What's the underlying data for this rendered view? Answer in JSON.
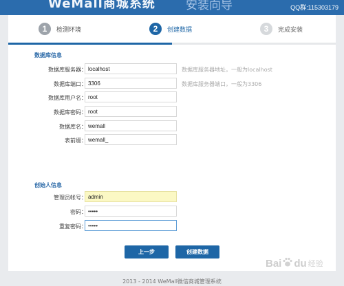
{
  "header": {
    "logo": "WeMall商城系统",
    "title": "安装向导",
    "qq": "QQ群:115303179"
  },
  "steps": [
    {
      "number": "1",
      "label": "检测环境",
      "state": "done"
    },
    {
      "number": "2",
      "label": "创建数据",
      "state": "active"
    },
    {
      "number": "3",
      "label": "完成安装",
      "state": "todo"
    }
  ],
  "progress": {
    "current_step": 2,
    "total_steps": 3,
    "fraction": 0.5
  },
  "database": {
    "section_title": "数据库信息",
    "server": {
      "label": "数据库服务器：",
      "value": "localhost",
      "hint": "数据库服务器地址，一般为localhost"
    },
    "port": {
      "label": "数据库端口：",
      "value": "3306",
      "hint": "数据库服务器端口，一般为3306"
    },
    "user": {
      "label": "数据库用户名：",
      "value": "root"
    },
    "password": {
      "label": "数据库密码：",
      "value": "root"
    },
    "name": {
      "label": "数据库名：",
      "value": "wemall"
    },
    "prefix": {
      "label": "表前缀：",
      "value": "wemall_"
    }
  },
  "founder": {
    "section_title": "创始人信息",
    "account": {
      "label": "管理员帐号：",
      "value": "admin"
    },
    "password": {
      "label": "密码：",
      "value": "admin"
    },
    "confirm": {
      "label": "重复密码：",
      "value": "admin"
    }
  },
  "buttons": {
    "prev": "上一步",
    "create": "创建数据"
  },
  "footer": "2013 - 2014 WeMall微信商城管理系统",
  "watermark": {
    "text": "Bai",
    "text2": "du",
    "cn": "经验"
  },
  "colors": {
    "accent": "#1e66a6",
    "header": "#2b6cad",
    "highlight_input": "#fbf8c4"
  }
}
